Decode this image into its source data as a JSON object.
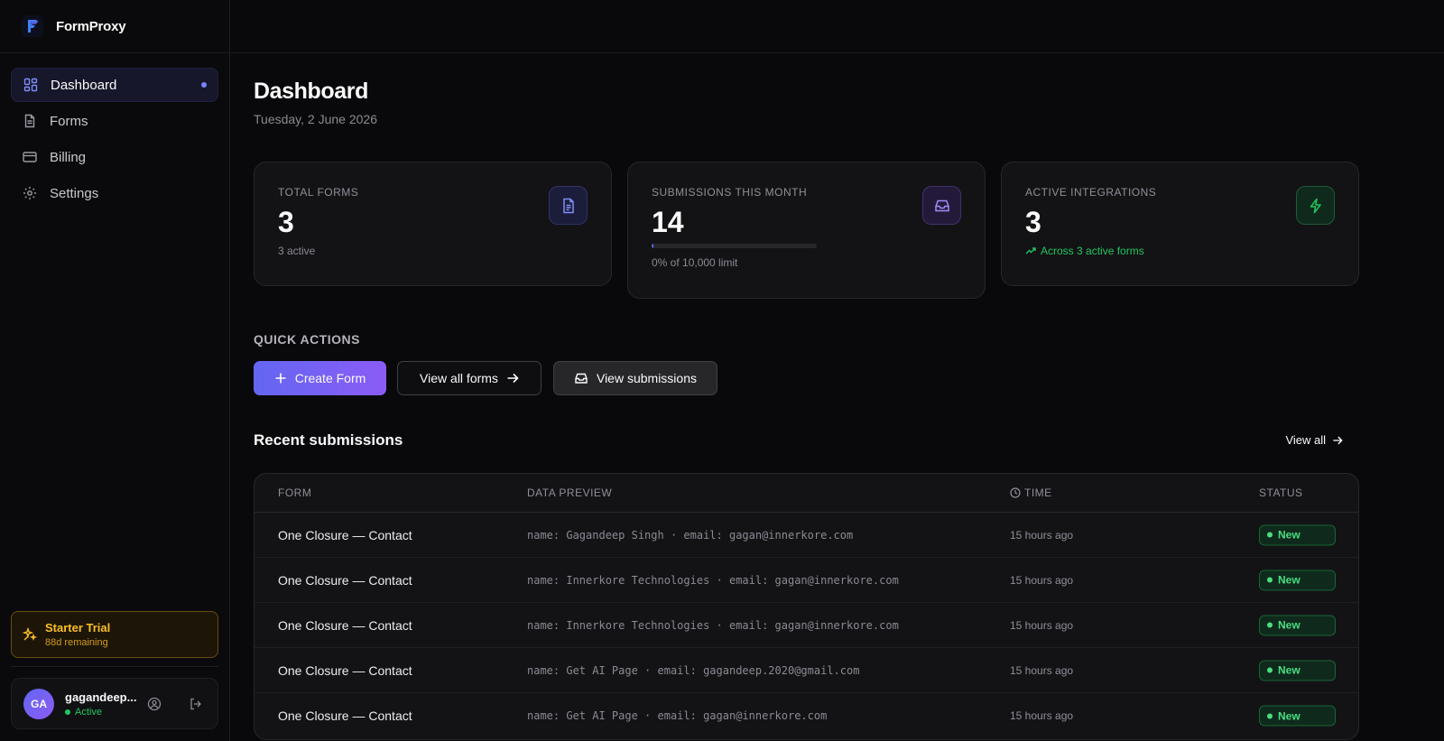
{
  "brand": {
    "name": "FormProxy"
  },
  "sidebar": {
    "items": [
      {
        "label": "Dashboard",
        "icon": "grid-icon",
        "active": true
      },
      {
        "label": "Forms",
        "icon": "file-icon",
        "active": false
      },
      {
        "label": "Billing",
        "icon": "credit-card-icon",
        "active": false
      },
      {
        "label": "Settings",
        "icon": "gear-icon",
        "active": false
      }
    ],
    "trial": {
      "title": "Starter Trial",
      "remaining": "88d remaining"
    },
    "user": {
      "initials": "GA",
      "name": "gagandeep...",
      "status": "Active"
    }
  },
  "page": {
    "title": "Dashboard",
    "date": "Tuesday, 2 June 2026"
  },
  "stats": {
    "total_forms": {
      "label": "TOTAL FORMS",
      "value": "3",
      "sub": "3 active"
    },
    "submissions": {
      "label": "SUBMISSIONS THIS MONTH",
      "value": "14",
      "sub": "0% of 10,000 limit",
      "progress_percent": 0
    },
    "integrations": {
      "label": "ACTIVE INTEGRATIONS",
      "value": "3",
      "sub": "Across 3 active forms"
    }
  },
  "quick_actions": {
    "label": "QUICK ACTIONS",
    "create": "Create Form",
    "view_forms": "View all forms",
    "view_submissions": "View submissions"
  },
  "recent": {
    "title": "Recent submissions",
    "view_all": "View all",
    "headers": {
      "form": "FORM",
      "preview": "DATA PREVIEW",
      "time": "TIME",
      "status": "STATUS"
    },
    "rows": [
      {
        "form": "One Closure — Contact",
        "preview": "name: Gagandeep Singh · email: gagan@innerkore.com",
        "time": "15 hours ago",
        "status": "New"
      },
      {
        "form": "One Closure — Contact",
        "preview": "name: Innerkore Technologies · email: gagan@innerkore.com",
        "time": "15 hours ago",
        "status": "New"
      },
      {
        "form": "One Closure — Contact",
        "preview": "name: Innerkore Technologies · email: gagan@innerkore.com",
        "time": "15 hours ago",
        "status": "New"
      },
      {
        "form": "One Closure — Contact",
        "preview": "name: Get AI Page · email: gagandeep.2020@gmail.com",
        "time": "15 hours ago",
        "status": "New"
      },
      {
        "form": "One Closure — Contact",
        "preview": "name: Get AI Page · email: gagan@innerkore.com",
        "time": "15 hours ago",
        "status": "New"
      }
    ]
  },
  "colors": {
    "accent": "#6366f1",
    "accent2": "#8b5cf6",
    "success": "#22c55e",
    "warning": "#fbbf24"
  }
}
